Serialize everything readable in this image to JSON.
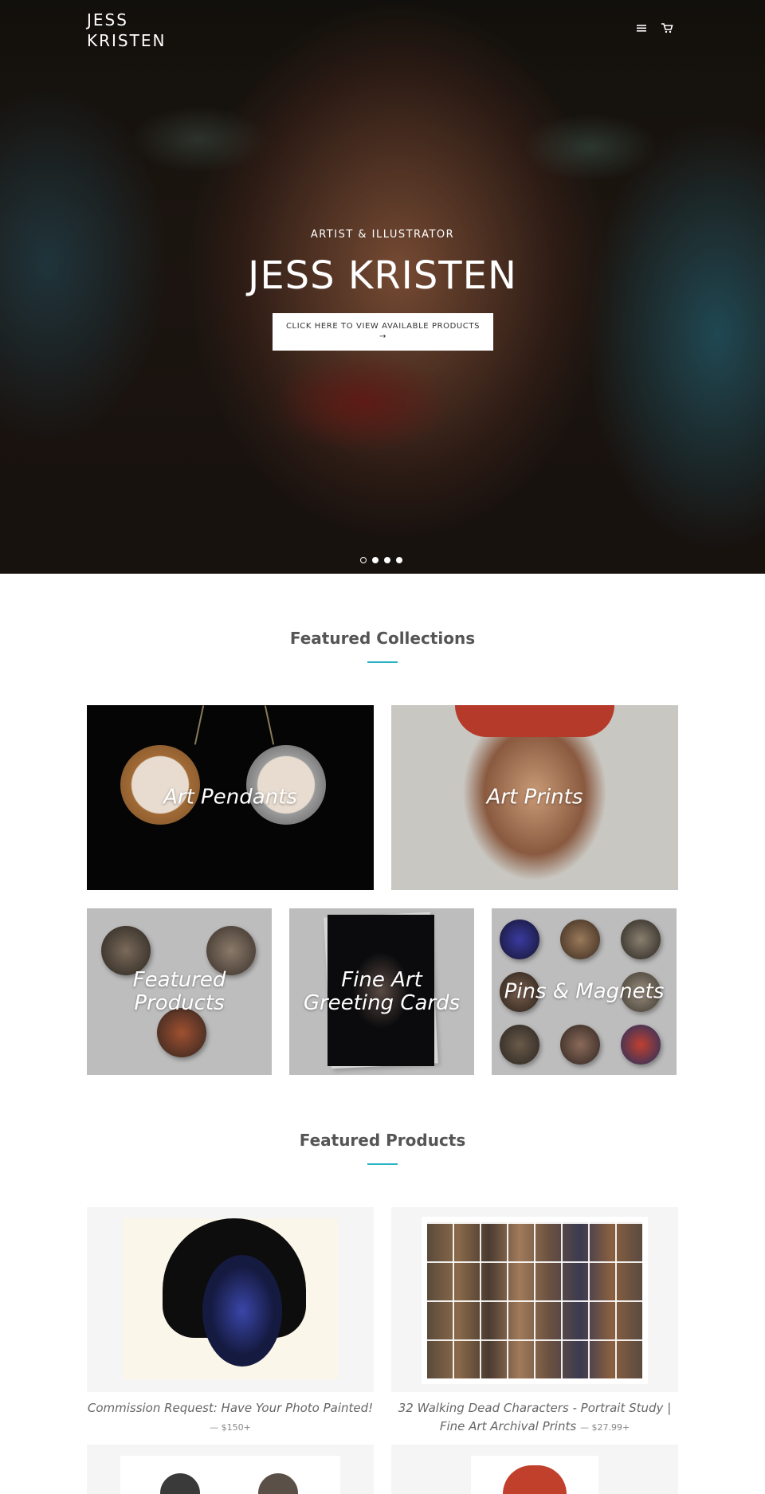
{
  "header": {
    "logo_line1": "JESS",
    "logo_line2": "KRISTEN",
    "icons": [
      "menu-icon",
      "cart-icon"
    ]
  },
  "hero": {
    "subtitle": "ARTIST & ILLUSTRATOR",
    "title": "JESS KRISTEN",
    "button_label": "CLICK HERE TO VIEW AVAILABLE PRODUCTS",
    "button_arrow": "→",
    "slide_count": 4,
    "active_slide": 1
  },
  "featured_collections": {
    "heading": "Featured Collections",
    "accent_color": "#2ab3c6",
    "items": [
      {
        "label": "Art Pendants"
      },
      {
        "label": "Art Prints"
      },
      {
        "label": "Featured Products"
      },
      {
        "label": "Fine Art Greeting Cards"
      },
      {
        "label": "Pins & Magnets"
      }
    ]
  },
  "featured_products": {
    "heading": "Featured Products",
    "items": [
      {
        "title": "Commission Request: Have Your Photo Painted!",
        "price": "— $150+"
      },
      {
        "title": "32 Walking Dead Characters - Portrait Study | Fine Art Archival Prints",
        "price": "— $27.99+"
      }
    ]
  }
}
